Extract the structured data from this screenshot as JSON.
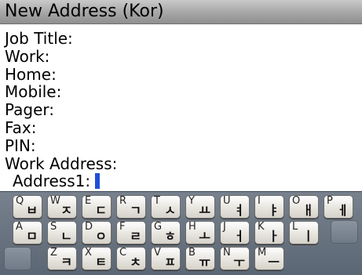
{
  "window": {
    "title": "New Address (Kor)"
  },
  "form": {
    "fields": [
      "Job Title:",
      "Work:",
      "Home:",
      "Mobile:",
      "Pager:",
      "Fax:",
      "PIN:",
      "Work Address:"
    ],
    "active_field": "Address1:"
  },
  "keyboard": {
    "rows": [
      [
        {
          "latin": "Q",
          "hangul": "ㅂ"
        },
        {
          "latin": "W",
          "hangul": "ㅈ"
        },
        {
          "latin": "E",
          "hangul": "ㄷ"
        },
        {
          "latin": "R",
          "hangul": "ㄱ"
        },
        {
          "latin": "T",
          "hangul": "ㅅ"
        },
        {
          "latin": "Y",
          "hangul": "ㅛ"
        },
        {
          "latin": "U",
          "hangul": "ㅕ"
        },
        {
          "latin": "I",
          "hangul": "ㅑ"
        },
        {
          "latin": "O",
          "hangul": "ㅐ"
        },
        {
          "latin": "P",
          "hangul": "ㅔ"
        }
      ],
      [
        {
          "latin": "A",
          "hangul": "ㅁ"
        },
        {
          "latin": "S",
          "hangul": "ㄴ"
        },
        {
          "latin": "D",
          "hangul": "ㅇ"
        },
        {
          "latin": "F",
          "hangul": "ㄹ"
        },
        {
          "latin": "G",
          "hangul": "ㅎ"
        },
        {
          "latin": "H",
          "hangul": "ㅗ"
        },
        {
          "latin": "J",
          "hangul": "ㅓ"
        },
        {
          "latin": "K",
          "hangul": "ㅏ"
        },
        {
          "latin": "L",
          "hangul": "ㅣ"
        }
      ],
      [
        {
          "latin": "Z",
          "hangul": "ㅋ"
        },
        {
          "latin": "X",
          "hangul": "ㅌ"
        },
        {
          "latin": "C",
          "hangul": "ㅊ"
        },
        {
          "latin": "V",
          "hangul": "ㅍ"
        },
        {
          "latin": "B",
          "hangul": "ㅠ"
        },
        {
          "latin": "N",
          "hangul": "ㅜ"
        },
        {
          "latin": "M",
          "hangul": "ㅡ"
        }
      ]
    ]
  },
  "colors": {
    "caret": "#1e4fd8",
    "keyboard_background": "#66717e"
  }
}
